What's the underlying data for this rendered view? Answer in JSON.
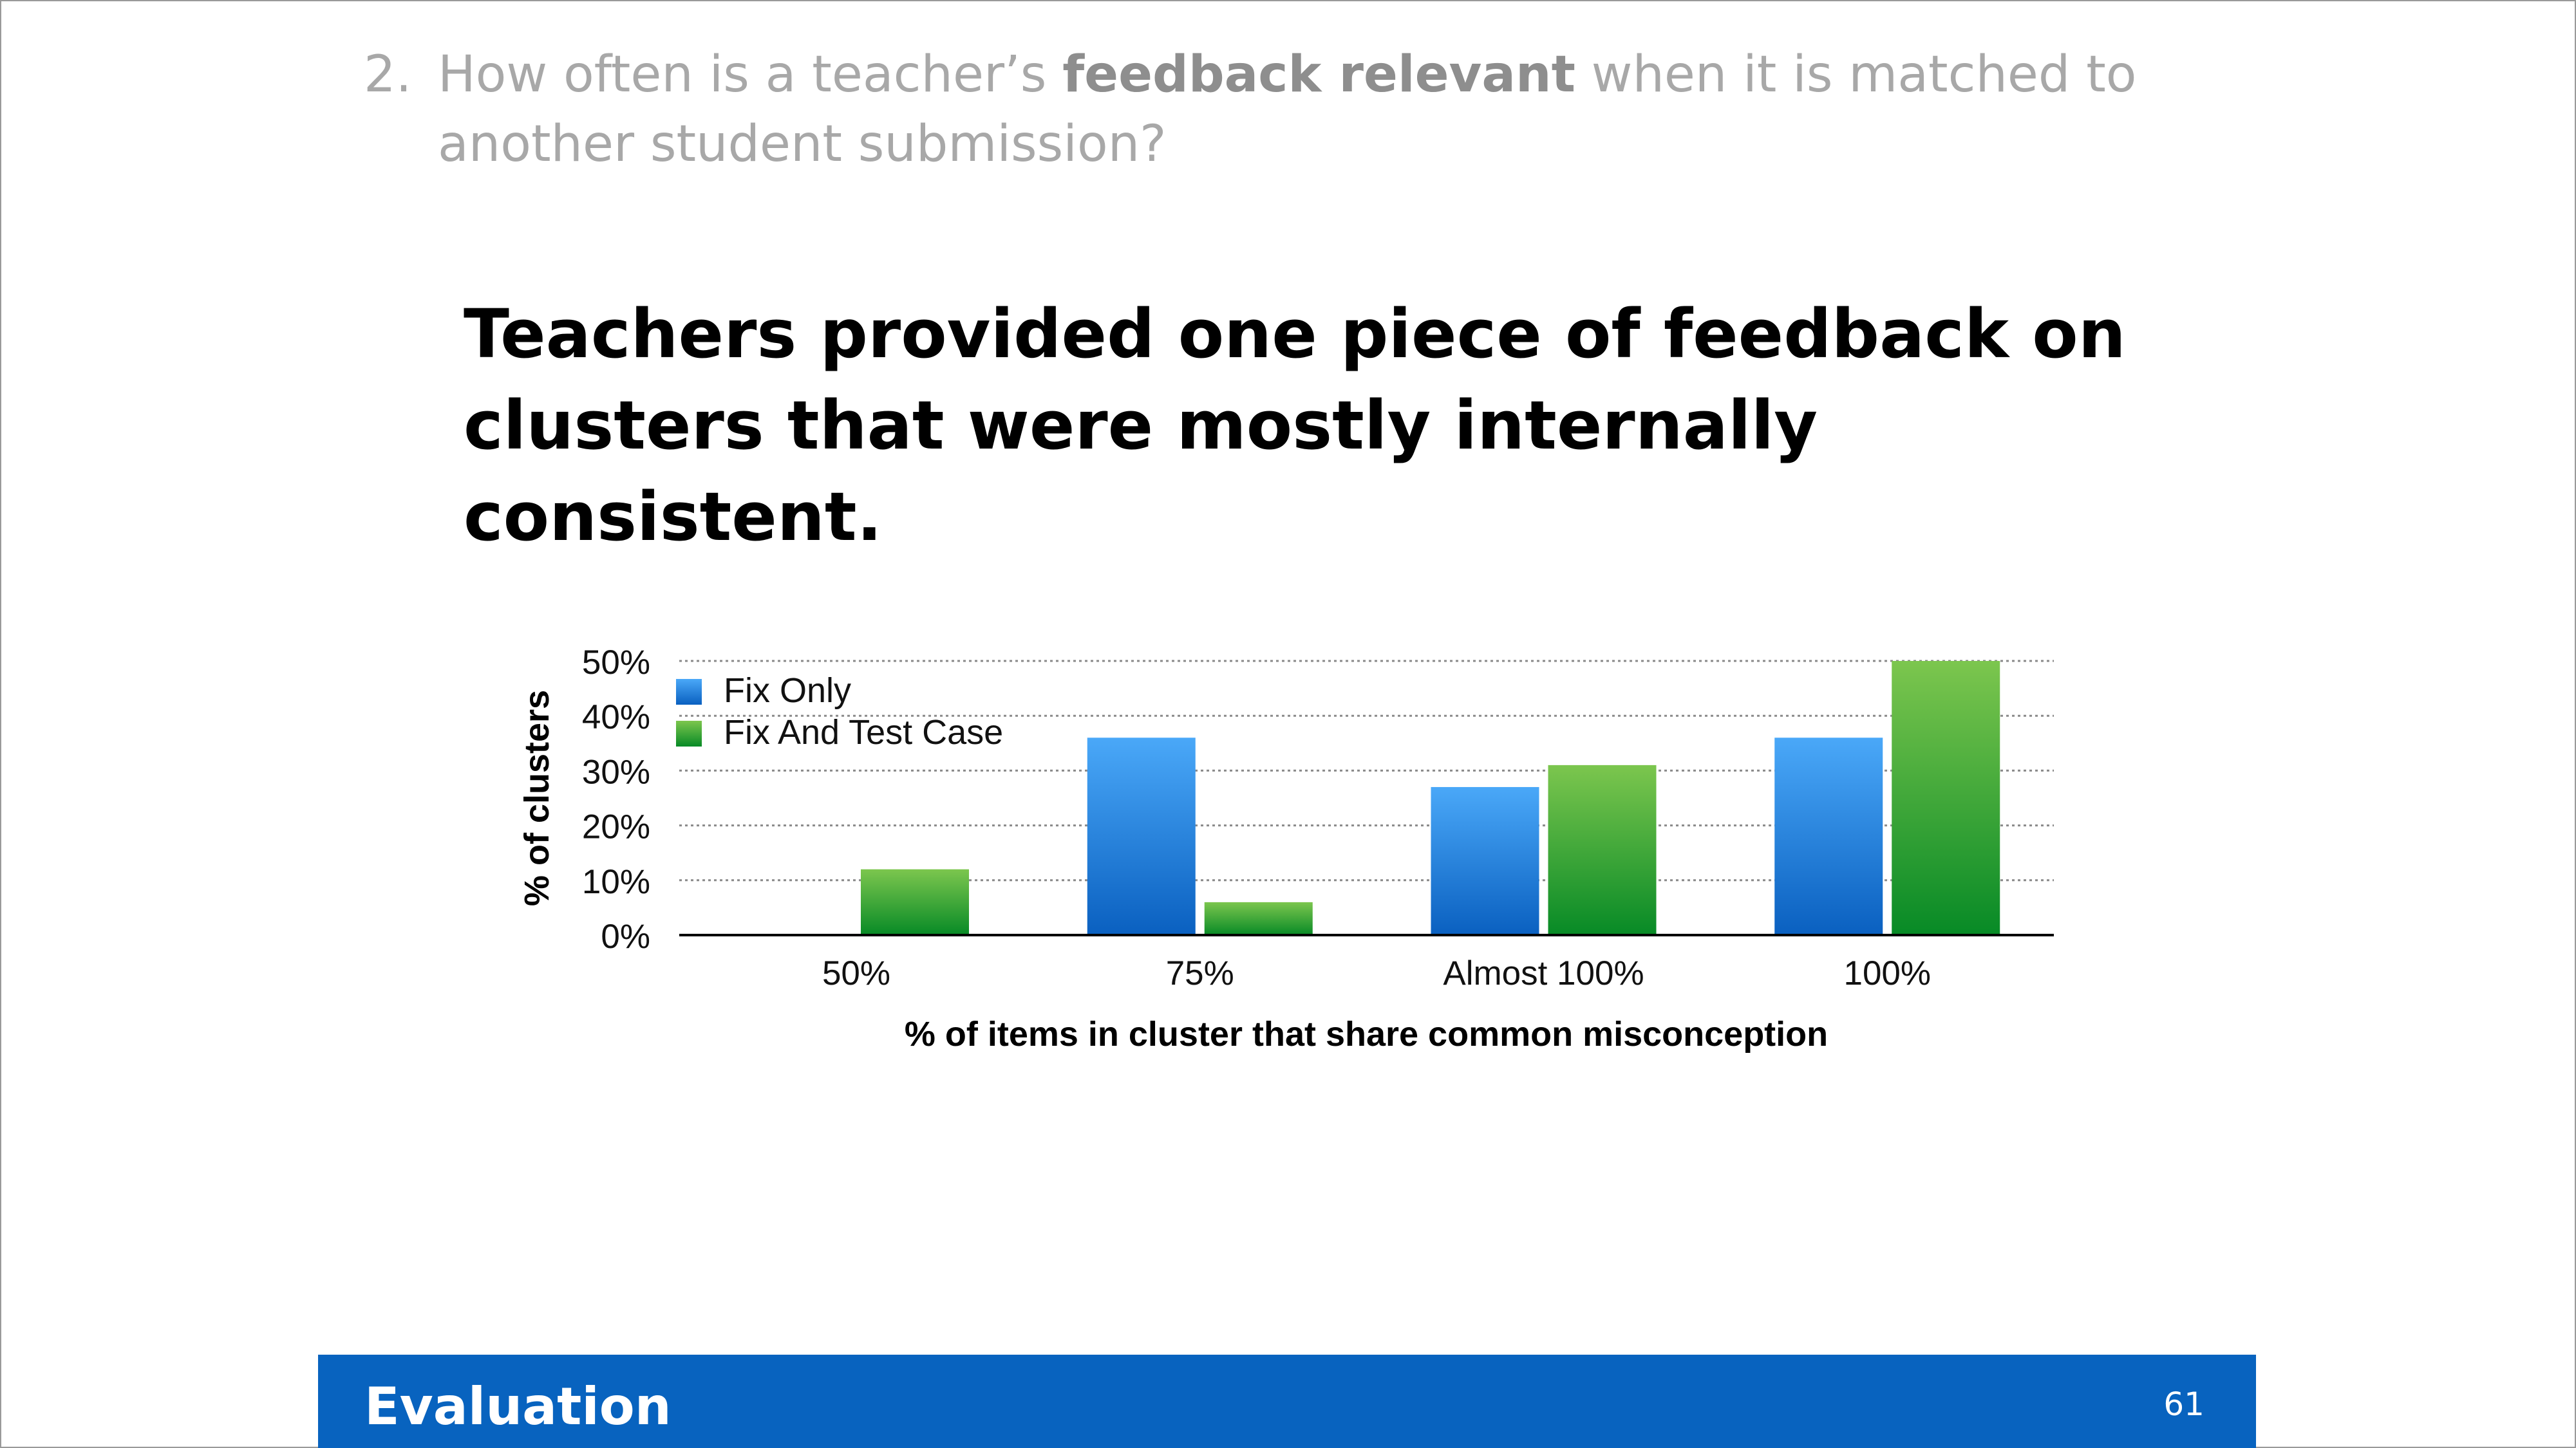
{
  "slide": {
    "question_number": "2.",
    "question_before": "How often is a teacher’s ",
    "question_bold": "feedback relevant",
    "question_after": " when it is matched to another student submission?",
    "headline": "Teachers provided one piece of feedback on clusters that were mostly internally consistent."
  },
  "footer": {
    "title": "Evaluation",
    "page_number": "61"
  },
  "chart_data": {
    "type": "bar",
    "categories": [
      "50%",
      "75%",
      "Almost 100%",
      "100%"
    ],
    "series": [
      {
        "name": "Fix Only",
        "values": [
          0,
          36,
          27,
          36
        ],
        "color": "#2f8fe8"
      },
      {
        "name": "Fix And Test Case",
        "values": [
          12,
          6,
          31,
          50
        ],
        "color": "#3aad3a"
      }
    ],
    "xlabel": "% of items in cluster that share common misconception",
    "ylabel": "% of clusters",
    "ylim": [
      0,
      50
    ],
    "yticks": [
      "0%",
      "10%",
      "20%",
      "30%",
      "40%",
      "50%"
    ],
    "grid": true,
    "legend": "top-left"
  }
}
